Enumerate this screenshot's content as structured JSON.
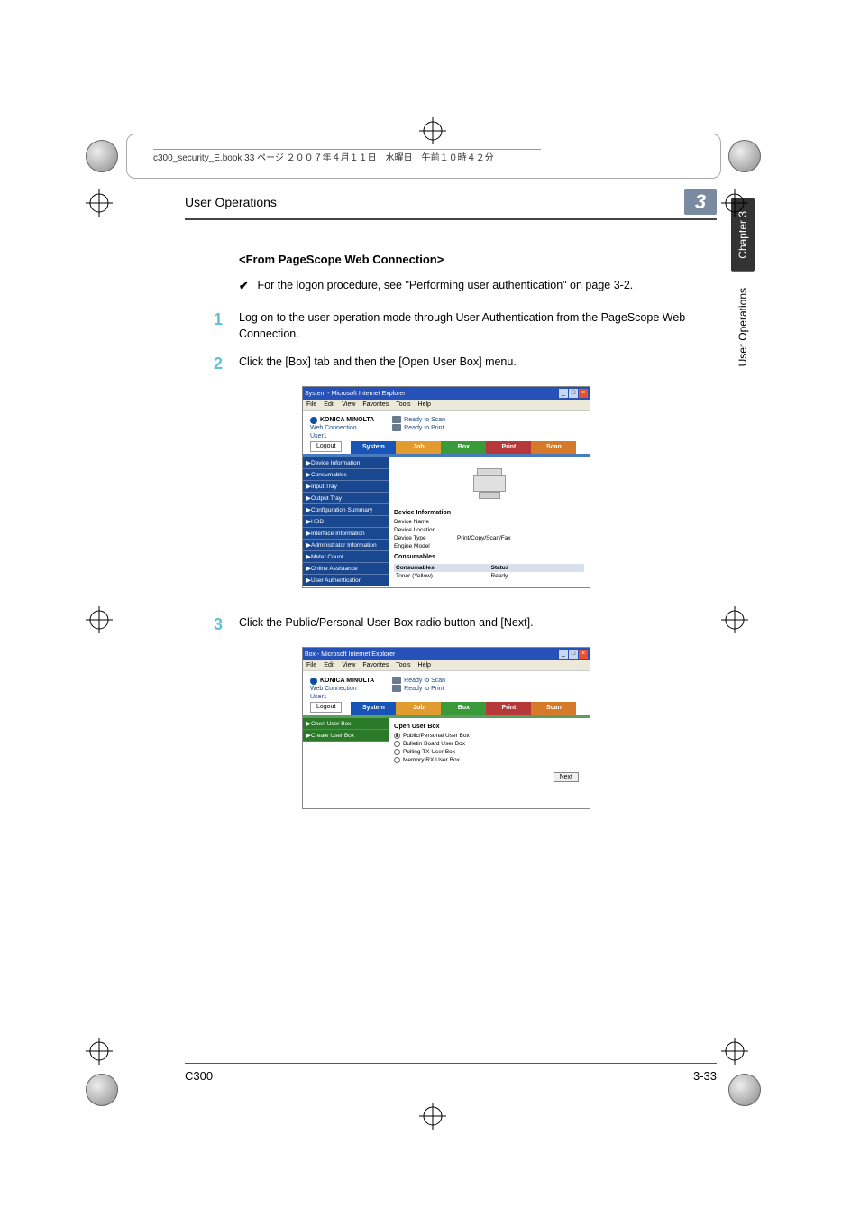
{
  "crop_info": "c300_security_E.book  33 ページ  ２００７年４月１１日　水曜日　午前１０時４２分",
  "header": {
    "title": "User Operations",
    "chapter_num": "3"
  },
  "side": {
    "chapter": "Chapter 3",
    "section": "User Operations"
  },
  "subhead": "<From PageScope Web Connection>",
  "bullet": "For the logon procedure, see \"Performing user authentication\" on page 3-2.",
  "steps": {
    "s1": {
      "num": "1",
      "text": "Log on to the user operation mode through User Authentication from the PageScope Web Connection."
    },
    "s2": {
      "num": "2",
      "text": "Click the [Box] tab and then the [Open User Box] menu."
    },
    "s3": {
      "num": "3",
      "text": "Click the Public/Personal User Box radio button and [Next]."
    }
  },
  "screenshot1": {
    "title": "System - Microsoft Internet Explorer",
    "menus": [
      "File",
      "Edit",
      "View",
      "Favorites",
      "Tools",
      "Help"
    ],
    "brand": "KONICA MINOLTA",
    "product": "Web Connection",
    "status1": "Ready to Scan",
    "status2": "Ready to Print",
    "user_label": "User1",
    "logout": "Logout",
    "tabs": {
      "system": "System",
      "job": "Job",
      "box": "Box",
      "print": "Print",
      "scan": "Scan"
    },
    "side_items": [
      "▶Device Information",
      "▶Consumables",
      "▶Input Tray",
      "▶Output Tray",
      "▶Configuration Summary",
      "▶HDD",
      "▶Interface Information",
      "▶Administrator Information",
      "▶Meter Count",
      "▶Online Assistance",
      "▶User Authentication"
    ],
    "device_info_head": "Device Information",
    "device_rows": {
      "r1": {
        "label": "Device Name",
        "value": ""
      },
      "r2": {
        "label": "Device Location",
        "value": ""
      },
      "r3": {
        "label": "Device Type",
        "value": "Print/Copy/Scan/Fax"
      },
      "r4": {
        "label": "Engine Model",
        "value": ""
      }
    },
    "cons_head": "Consumables",
    "cons_cols": {
      "c1": "Consumables",
      "c2": "Status"
    },
    "cons_row": {
      "c1": "Toner (Yellow)",
      "c2": "Ready"
    }
  },
  "screenshot2": {
    "title": "Box - Microsoft Internet Explorer",
    "menus": [
      "File",
      "Edit",
      "View",
      "Favorites",
      "Tools",
      "Help"
    ],
    "brand": "KONICA MINOLTA",
    "product": "Web Connection",
    "status1": "Ready to Scan",
    "status2": "Ready to Print",
    "user_label": "User1",
    "logout": "Logout",
    "tabs": {
      "system": "System",
      "job": "Job",
      "box": "Box",
      "print": "Print",
      "scan": "Scan"
    },
    "side_items": [
      "▶Open User Box",
      "▶Create User Box"
    ],
    "open_title": "Open User Box",
    "radios": {
      "r1": "Public/Personal User Box",
      "r2": "Bulletin Board User Box",
      "r3": "Polling TX User Box",
      "r4": "Memory RX User Box"
    },
    "next": "Next"
  },
  "footer": {
    "left": "C300",
    "right": "3-33"
  }
}
